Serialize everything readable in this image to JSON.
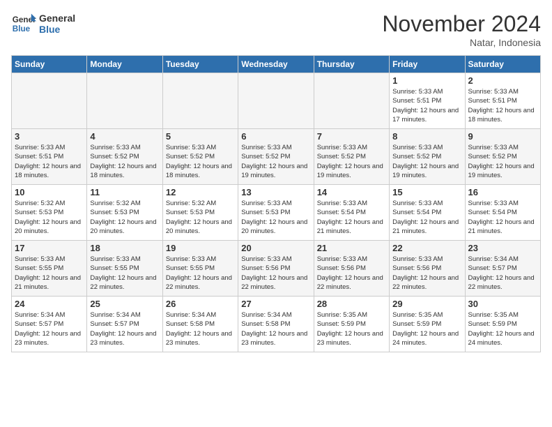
{
  "header": {
    "logo_line1": "General",
    "logo_line2": "Blue",
    "month": "November 2024",
    "location": "Natar, Indonesia"
  },
  "days_of_week": [
    "Sunday",
    "Monday",
    "Tuesday",
    "Wednesday",
    "Thursday",
    "Friday",
    "Saturday"
  ],
  "weeks": [
    [
      {
        "day": "",
        "empty": true
      },
      {
        "day": "",
        "empty": true
      },
      {
        "day": "",
        "empty": true
      },
      {
        "day": "",
        "empty": true
      },
      {
        "day": "",
        "empty": true
      },
      {
        "day": "1",
        "sunrise": "5:33 AM",
        "sunset": "5:51 PM",
        "daylight": "12 hours and 17 minutes."
      },
      {
        "day": "2",
        "sunrise": "5:33 AM",
        "sunset": "5:51 PM",
        "daylight": "12 hours and 18 minutes."
      }
    ],
    [
      {
        "day": "3",
        "sunrise": "5:33 AM",
        "sunset": "5:51 PM",
        "daylight": "12 hours and 18 minutes."
      },
      {
        "day": "4",
        "sunrise": "5:33 AM",
        "sunset": "5:52 PM",
        "daylight": "12 hours and 18 minutes."
      },
      {
        "day": "5",
        "sunrise": "5:33 AM",
        "sunset": "5:52 PM",
        "daylight": "12 hours and 18 minutes."
      },
      {
        "day": "6",
        "sunrise": "5:33 AM",
        "sunset": "5:52 PM",
        "daylight": "12 hours and 19 minutes."
      },
      {
        "day": "7",
        "sunrise": "5:33 AM",
        "sunset": "5:52 PM",
        "daylight": "12 hours and 19 minutes."
      },
      {
        "day": "8",
        "sunrise": "5:33 AM",
        "sunset": "5:52 PM",
        "daylight": "12 hours and 19 minutes."
      },
      {
        "day": "9",
        "sunrise": "5:33 AM",
        "sunset": "5:52 PM",
        "daylight": "12 hours and 19 minutes."
      }
    ],
    [
      {
        "day": "10",
        "sunrise": "5:32 AM",
        "sunset": "5:53 PM",
        "daylight": "12 hours and 20 minutes."
      },
      {
        "day": "11",
        "sunrise": "5:32 AM",
        "sunset": "5:53 PM",
        "daylight": "12 hours and 20 minutes."
      },
      {
        "day": "12",
        "sunrise": "5:32 AM",
        "sunset": "5:53 PM",
        "daylight": "12 hours and 20 minutes."
      },
      {
        "day": "13",
        "sunrise": "5:33 AM",
        "sunset": "5:53 PM",
        "daylight": "12 hours and 20 minutes."
      },
      {
        "day": "14",
        "sunrise": "5:33 AM",
        "sunset": "5:54 PM",
        "daylight": "12 hours and 21 minutes."
      },
      {
        "day": "15",
        "sunrise": "5:33 AM",
        "sunset": "5:54 PM",
        "daylight": "12 hours and 21 minutes."
      },
      {
        "day": "16",
        "sunrise": "5:33 AM",
        "sunset": "5:54 PM",
        "daylight": "12 hours and 21 minutes."
      }
    ],
    [
      {
        "day": "17",
        "sunrise": "5:33 AM",
        "sunset": "5:55 PM",
        "daylight": "12 hours and 21 minutes."
      },
      {
        "day": "18",
        "sunrise": "5:33 AM",
        "sunset": "5:55 PM",
        "daylight": "12 hours and 22 minutes."
      },
      {
        "day": "19",
        "sunrise": "5:33 AM",
        "sunset": "5:55 PM",
        "daylight": "12 hours and 22 minutes."
      },
      {
        "day": "20",
        "sunrise": "5:33 AM",
        "sunset": "5:56 PM",
        "daylight": "12 hours and 22 minutes."
      },
      {
        "day": "21",
        "sunrise": "5:33 AM",
        "sunset": "5:56 PM",
        "daylight": "12 hours and 22 minutes."
      },
      {
        "day": "22",
        "sunrise": "5:33 AM",
        "sunset": "5:56 PM",
        "daylight": "12 hours and 22 minutes."
      },
      {
        "day": "23",
        "sunrise": "5:34 AM",
        "sunset": "5:57 PM",
        "daylight": "12 hours and 22 minutes."
      }
    ],
    [
      {
        "day": "24",
        "sunrise": "5:34 AM",
        "sunset": "5:57 PM",
        "daylight": "12 hours and 23 minutes."
      },
      {
        "day": "25",
        "sunrise": "5:34 AM",
        "sunset": "5:57 PM",
        "daylight": "12 hours and 23 minutes."
      },
      {
        "day": "26",
        "sunrise": "5:34 AM",
        "sunset": "5:58 PM",
        "daylight": "12 hours and 23 minutes."
      },
      {
        "day": "27",
        "sunrise": "5:34 AM",
        "sunset": "5:58 PM",
        "daylight": "12 hours and 23 minutes."
      },
      {
        "day": "28",
        "sunrise": "5:35 AM",
        "sunset": "5:59 PM",
        "daylight": "12 hours and 23 minutes."
      },
      {
        "day": "29",
        "sunrise": "5:35 AM",
        "sunset": "5:59 PM",
        "daylight": "12 hours and 24 minutes."
      },
      {
        "day": "30",
        "sunrise": "5:35 AM",
        "sunset": "5:59 PM",
        "daylight": "12 hours and 24 minutes."
      }
    ]
  ],
  "labels": {
    "sunrise": "Sunrise:",
    "sunset": "Sunset:",
    "daylight": "Daylight:"
  }
}
